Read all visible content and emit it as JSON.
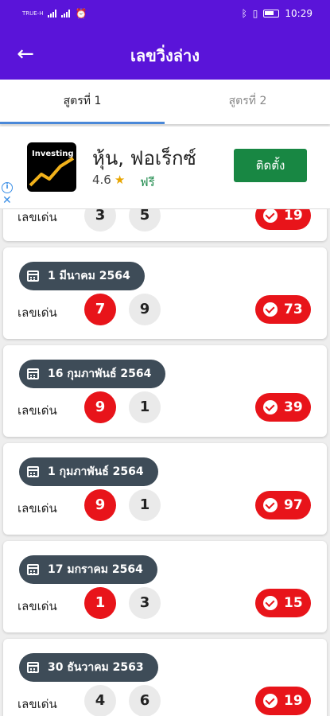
{
  "status": {
    "carrier": "TRUE-H",
    "time": "10:29"
  },
  "appbar": {
    "title": "เลขวิ่งล่าง"
  },
  "tabs": [
    {
      "label": "สูตรที่ 1"
    },
    {
      "label": "สูตรที่ 2"
    }
  ],
  "ad": {
    "logo_text": "Investing",
    "app_name": "หุ้น, ฟอเร็กซ์",
    "rating": "4.6",
    "price": "ฟรี",
    "install_label": "ติดตั้ง"
  },
  "colors": {
    "primary": "#5a14d9",
    "hit": "#e8141a",
    "chip": "#3e4c58",
    "install": "#188743"
  },
  "rows": [
    {
      "date": "",
      "label": "เลขเด่น",
      "numbers": [
        "3",
        "5"
      ],
      "score": "19"
    },
    {
      "date": "1 มีนาคม 2564",
      "label": "เลขเด่น",
      "numbers": [
        "7",
        "9"
      ],
      "score": "73"
    },
    {
      "date": "16 กุมภาพันธ์ 2564",
      "label": "เลขเด่น",
      "numbers": [
        "9",
        "1"
      ],
      "score": "39"
    },
    {
      "date": "1 กุมภาพันธ์ 2564",
      "label": "เลขเด่น",
      "numbers": [
        "9",
        "1"
      ],
      "score": "97"
    },
    {
      "date": "17 มกราคม 2564",
      "label": "เลขเด่น",
      "numbers": [
        "1",
        "3"
      ],
      "score": "15"
    },
    {
      "date": "30 ธันวาคม 2563",
      "label": "เลขเด่น",
      "numbers": [
        "4",
        "6"
      ],
      "score": "19"
    }
  ]
}
